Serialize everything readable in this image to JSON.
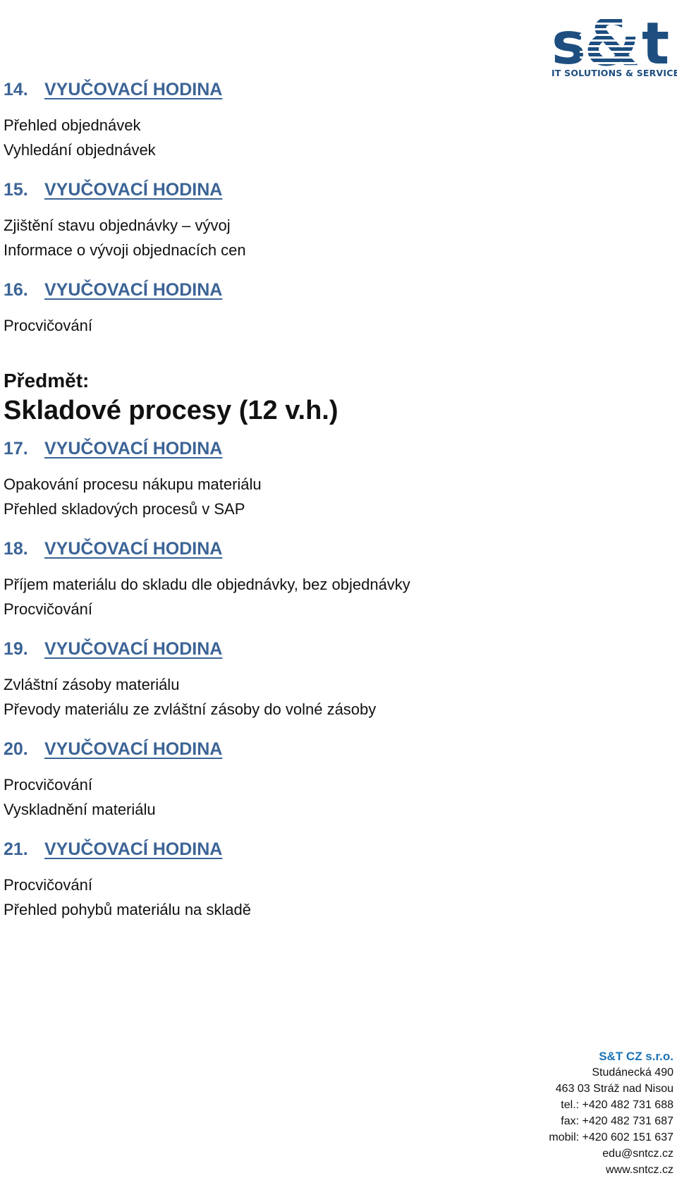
{
  "header": {
    "logo_text": "IT SOLUTIONS & SERVICES",
    "brand_color": "#1d4e7f",
    "heading_color": "#3c6496"
  },
  "lessons_a": [
    {
      "num": "14.",
      "title": "VYUČOVACÍ HODINA",
      "lines": [
        "Přehled objednávek",
        "Vyhledání objednávek"
      ]
    },
    {
      "num": "15.",
      "title": "VYUČOVACÍ HODINA",
      "lines": [
        "Zjištění stavu objednávky – vývoj",
        "Informace o vývoji objednacích cen"
      ]
    },
    {
      "num": "16.",
      "title": "VYUČOVACÍ HODINA",
      "lines": [
        "Procvičování"
      ]
    }
  ],
  "subject": {
    "label": "Předmět:",
    "title": "Skladové procesy (12 v.h.)"
  },
  "lessons_b": [
    {
      "num": "17.",
      "title": "VYUČOVACÍ HODINA",
      "lines": [
        "Opakování procesu nákupu materiálu",
        "Přehled skladových procesů v SAP"
      ]
    },
    {
      "num": "18.",
      "title": "VYUČOVACÍ HODINA",
      "lines": [
        "Příjem materiálu do skladu dle objednávky, bez objednávky",
        "Procvičování"
      ]
    },
    {
      "num": "19.",
      "title": "VYUČOVACÍ HODINA",
      "lines": [
        "Zvláštní zásoby materiálu",
        "Převody materiálu ze zvláštní zásoby do volné zásoby"
      ]
    },
    {
      "num": "20.",
      "title": "VYUČOVACÍ HODINA",
      "lines": [
        "Procvičování",
        "Vyskladnění materiálu"
      ]
    },
    {
      "num": "21.",
      "title": "VYUČOVACÍ HODINA",
      "lines": [
        "Procvičování",
        "Přehled pohybů materiálu na skladě"
      ]
    }
  ],
  "footer": {
    "company": "S&T CZ s.r.o.",
    "street": "Studánecká 490",
    "city": "463 03 Stráž nad Nisou",
    "tel": "tel.: +420 482 731 688",
    "fax": "fax: +420 482 731 687",
    "mobil": "mobil: +420 602 151 637",
    "email": "edu@sntcz.cz",
    "web": "www.sntcz.cz"
  }
}
